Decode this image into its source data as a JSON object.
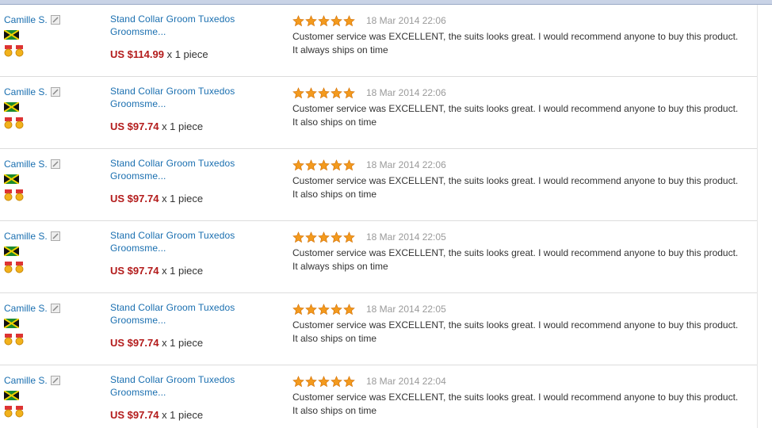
{
  "reviews": [
    {
      "buyer": "Camille S.",
      "product_title_1": "Stand Collar Groom Tuxedos",
      "product_title_2": "Groomsme...",
      "price": "US $114.99",
      "qty": "x 1 piece",
      "rating": 5,
      "date": "18 Mar 2014 22:06",
      "comment_1": "Customer service was EXCELLENT, the suits looks great. I would recommend anyone to buy this product.",
      "comment_2": "It always ships on time"
    },
    {
      "buyer": "Camille S.",
      "product_title_1": "Stand Collar Groom Tuxedos",
      "product_title_2": "Groomsme...",
      "price": "US $97.74",
      "qty": "x 1 piece",
      "rating": 5,
      "date": "18 Mar 2014 22:06",
      "comment_1": "Customer service was EXCELLENT, the suits looks great. I would recommend anyone to buy this product.",
      "comment_2": "It also ships on time"
    },
    {
      "buyer": "Camille S.",
      "product_title_1": "Stand Collar Groom Tuxedos",
      "product_title_2": "Groomsme...",
      "price": "US $97.74",
      "qty": "x 1 piece",
      "rating": 5,
      "date": "18 Mar 2014 22:06",
      "comment_1": "Customer service was EXCELLENT, the suits looks great. I would recommend anyone to buy this product.",
      "comment_2": "It also ships on time"
    },
    {
      "buyer": "Camille S.",
      "product_title_1": "Stand Collar Groom Tuxedos",
      "product_title_2": "Groomsme...",
      "price": "US $97.74",
      "qty": "x 1 piece",
      "rating": 5,
      "date": "18 Mar 2014 22:05",
      "comment_1": "Customer service was EXCELLENT, the suits looks great. I would recommend anyone to buy this product.",
      "comment_2": "It always ships on time"
    },
    {
      "buyer": "Camille S.",
      "product_title_1": "Stand Collar Groom Tuxedos",
      "product_title_2": "Groomsme...",
      "price": "US $97.74",
      "qty": "x 1 piece",
      "rating": 5,
      "date": "18 Mar 2014 22:05",
      "comment_1": "Customer service was EXCELLENT, the suits looks great. I would recommend anyone to buy this product.",
      "comment_2": "It also ships on time"
    },
    {
      "buyer": "Camille S.",
      "product_title_1": "Stand Collar Groom Tuxedos",
      "product_title_2": "Groomsme...",
      "price": "US $97.74",
      "qty": "x 1 piece",
      "rating": 5,
      "date": "18 Mar 2014 22:04",
      "comment_1": "Customer service was EXCELLENT, the suits looks great. I would recommend anyone to buy this product.",
      "comment_2": "It also ships on time"
    }
  ],
  "icons": {
    "edit": "edit-icon",
    "flag": "jamaica-flag-icon",
    "medal": "medal-icon",
    "star": "star-icon"
  },
  "colors": {
    "link": "#1a6fb0",
    "price": "#b31b1b",
    "star": "#f39a1e",
    "date": "#9a9a9a"
  }
}
